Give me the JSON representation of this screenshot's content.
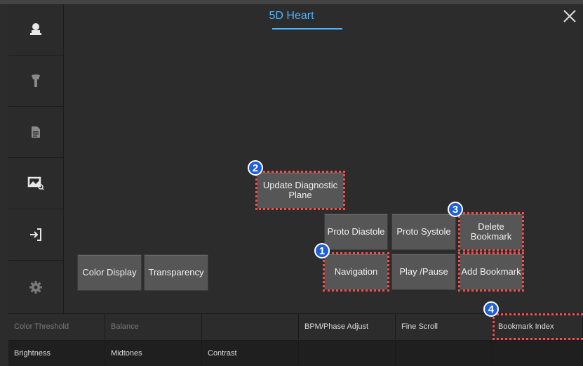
{
  "header": {
    "title": "5D Heart",
    "close_icon": "close-icon"
  },
  "sidebar": {
    "items": [
      {
        "icon": "patient-icon"
      },
      {
        "icon": "probe-icon"
      },
      {
        "icon": "report-icon"
      },
      {
        "icon": "image-review-icon"
      },
      {
        "icon": "exit-icon"
      },
      {
        "icon": "settings-icon"
      }
    ]
  },
  "buttons": {
    "update_diagnostic_plane": "Update Diagnostic Plane",
    "proto_diastole": "Proto Diastole",
    "proto_systole": "Proto Systole",
    "delete_bookmark": "Delete Bookmark",
    "navigation": "Navigation",
    "play_pause": "Play /Pause",
    "add_bookmark": "Add Bookmark",
    "color_display": "Color Display",
    "transparency": "Transparency"
  },
  "badges": {
    "b1": "1",
    "b2": "2",
    "b3": "3",
    "b4": "4"
  },
  "controls": {
    "row1": [
      "Color Threshold",
      "Balance",
      "",
      "BPM/Phase Adjust",
      "Fine Scroll",
      "Bookmark Index"
    ],
    "row2": [
      "Brightness",
      "Midtones",
      "Contrast",
      "",
      "",
      ""
    ]
  },
  "colors": {
    "accent": "#4fb5ff",
    "highlight": "#ff4a4a",
    "badge": "#1f5fd6"
  }
}
